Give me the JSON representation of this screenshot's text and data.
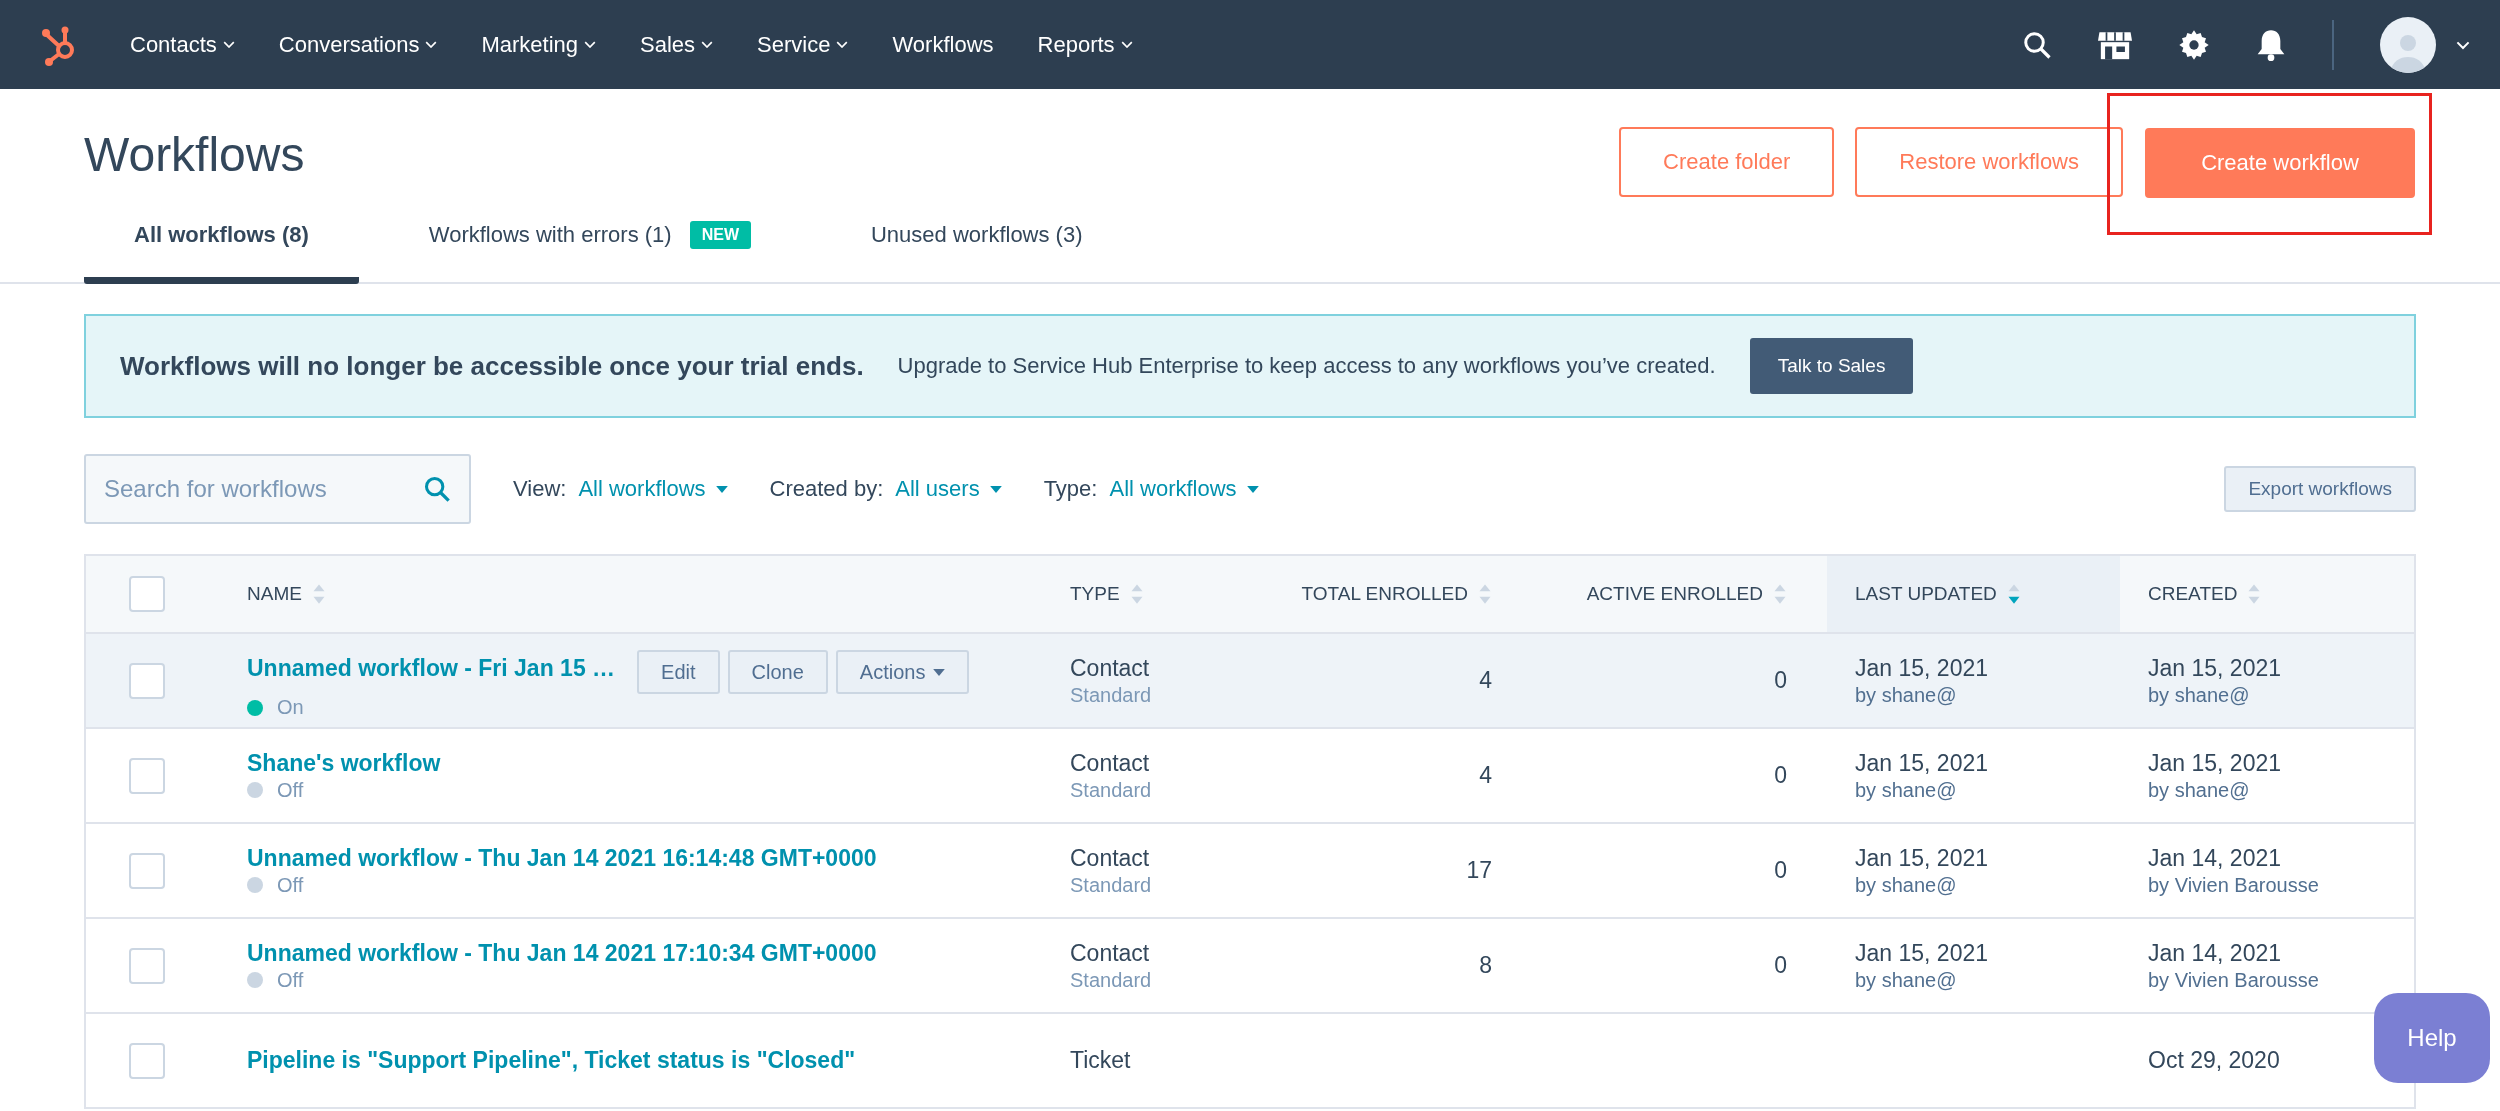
{
  "nav": {
    "items": [
      {
        "label": "Contacts",
        "dropdown": true
      },
      {
        "label": "Conversations",
        "dropdown": true
      },
      {
        "label": "Marketing",
        "dropdown": true
      },
      {
        "label": "Sales",
        "dropdown": true
      },
      {
        "label": "Service",
        "dropdown": true
      },
      {
        "label": "Workflows",
        "dropdown": false
      },
      {
        "label": "Reports",
        "dropdown": true
      }
    ]
  },
  "page": {
    "title": "Workflows",
    "actions": [
      {
        "label": "Create folder",
        "kind": "outline",
        "highlighted": false
      },
      {
        "label": "Restore workflows",
        "kind": "outline",
        "highlighted": false
      },
      {
        "label": "Create workflow",
        "kind": "primary",
        "highlighted": true
      }
    ]
  },
  "tabs": [
    {
      "label": "All workflows (8)",
      "selected": true
    },
    {
      "label": "Workflows with errors (1)",
      "selected": false,
      "badge": "NEW"
    },
    {
      "label": "Unused workflows (3)",
      "selected": false
    }
  ],
  "banner": {
    "heading": "Workflows will no longer be accessible once your trial ends.",
    "text": "Upgrade to Service Hub Enterprise to keep access to any workflows you’ve created.",
    "button": "Talk to Sales"
  },
  "filters": {
    "search": {
      "placeholder": "Search for workflows"
    },
    "dropdowns": [
      {
        "label": "View:",
        "value": "All workflows"
      },
      {
        "label": "Created by:",
        "value": "All users"
      },
      {
        "label": "Type:",
        "value": "All workflows"
      }
    ],
    "export_button": "Export workflows"
  },
  "table": {
    "select_all": {
      "checked": false
    },
    "columns": [
      {
        "label": "NAME",
        "sorted": false
      },
      {
        "label": "TYPE",
        "sorted": false
      },
      {
        "label": "TOTAL ENROLLED",
        "sorted": false
      },
      {
        "label": "ACTIVE ENROLLED",
        "sorted": false
      },
      {
        "label": "LAST UPDATED",
        "sorted": true
      },
      {
        "label": "CREATED",
        "sorted": false
      }
    ],
    "rows": [
      {
        "checked": false,
        "highlighted": true,
        "name": "Unnamed workflow - Fri Jan 15 …",
        "on": true,
        "status": "On",
        "row_actions": [
          {
            "label": "Edit",
            "dropdown": false
          },
          {
            "label": "Clone",
            "dropdown": false
          },
          {
            "label": "Actions",
            "dropdown": true
          }
        ],
        "type": "Contact",
        "subtype": "Standard",
        "total": "4",
        "active": "0",
        "updated": "Jan 15, 2021",
        "updated_by": "by shane@",
        "created": "Jan 15, 2021",
        "created_by": "by shane@"
      },
      {
        "checked": false,
        "highlighted": false,
        "name": "Shane's workflow",
        "on": false,
        "status": "Off",
        "type": "Contact",
        "subtype": "Standard",
        "total": "4",
        "active": "0",
        "updated": "Jan 15, 2021",
        "updated_by": "by shane@",
        "created": "Jan 15, 2021",
        "created_by": "by shane@"
      },
      {
        "checked": false,
        "highlighted": false,
        "name": "Unnamed workflow - Thu Jan 14 2021 16:14:48 GMT+0000",
        "on": false,
        "status": "Off",
        "type": "Contact",
        "subtype": "Standard",
        "total": "17",
        "active": "0",
        "updated": "Jan 15, 2021",
        "updated_by": "by shane@",
        "created": "Jan 14, 2021",
        "created_by": "by Vivien Barousse"
      },
      {
        "checked": false,
        "highlighted": false,
        "name": "Unnamed workflow - Thu Jan 14 2021 17:10:34 GMT+0000",
        "on": false,
        "status": "Off",
        "type": "Contact",
        "subtype": "Standard",
        "total": "8",
        "active": "0",
        "updated": "Jan 15, 2021",
        "updated_by": "by shane@",
        "created": "Jan 14, 2021",
        "created_by": "by Vivien Barousse"
      },
      {
        "checked": false,
        "highlighted": false,
        "name": "Pipeline is \"Support Pipeline\", Ticket status is \"Closed\"",
        "type": "Ticket",
        "created": "Oct 29, 2020"
      }
    ]
  },
  "help_button": "Help"
}
